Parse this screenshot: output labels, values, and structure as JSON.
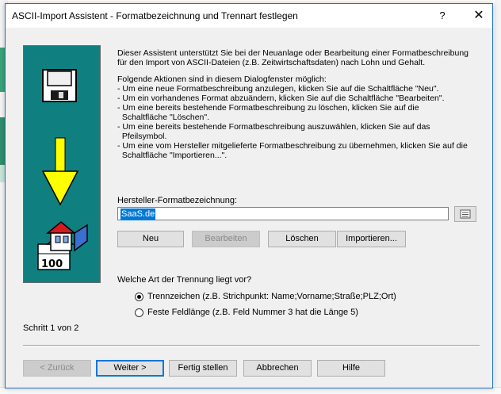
{
  "dialog": {
    "title": "ASCII-Import Assistent - Formatbezeichnung und Trennart festlegen",
    "help_label": "?",
    "close_label": "✕"
  },
  "description": {
    "intro_lines": [
      "Dieser Assistent unterstützt Sie bei der Neuanlage oder Bearbeitung einer Formatbeschreibung",
      "für den Import von ASCII-Dateien (z.B. Zeitwirtschaftsdaten) nach Lohn und Gehalt."
    ],
    "actions_lines": [
      "Folgende Aktionen sind in diesem Dialogfenster möglich:",
      "- Um eine neue Formatbeschreibung anzulegen, klicken Sie auf die Schaltfläche \"Neu\".",
      "- Um ein vorhandenes Format abzuändern, klicken Sie auf die Schaltfläche \"Bearbeiten\".",
      "- Um eine bereits bestehende Formatbeschreibung zu löschen, klicken Sie auf die",
      "  Schaltfläche \"Löschen\".",
      "- Um eine bereits bestehende Formatbeschreibung auszuwählen, klicken Sie auf das",
      "  Pfeilsymbol.",
      "- Um eine vom Hersteller mitgelieferte Formatbeschreibung zu übernehmen, klicken Sie auf die",
      "  Schaltfläche \"Importieren...\"."
    ]
  },
  "format": {
    "label": "Hersteller-Formatbezeichnung:",
    "value": "SaaS.de"
  },
  "format_buttons": {
    "neu": "Neu",
    "bearbeiten": "Bearbeiten",
    "loeschen": "Löschen",
    "importieren": "Importieren..."
  },
  "trennung": {
    "question": "Welche Art der Trennung liegt vor?",
    "options": [
      {
        "label": "Trennzeichen (z.B. Strichpunkt: Name;Vorname;Straße;PLZ;Ort)",
        "selected": true
      },
      {
        "label": "Feste Feldlänge (z.B. Feld Nummer 3 hat die Länge 5)",
        "selected": false
      }
    ]
  },
  "step": "Schritt 1 von 2",
  "footer": {
    "back": "< Zurück",
    "next": "Weiter >",
    "finish": "Fertig stellen",
    "cancel": "Abbrechen",
    "help": "Hilfe"
  },
  "illustration": {
    "icons": [
      "floppy-disk-icon",
      "arrow-down-icon",
      "house-and-calendar-icon"
    ],
    "calendar_text": "100",
    "panel_color": "#0f7f7f",
    "arrow_color": "#ffff00"
  }
}
